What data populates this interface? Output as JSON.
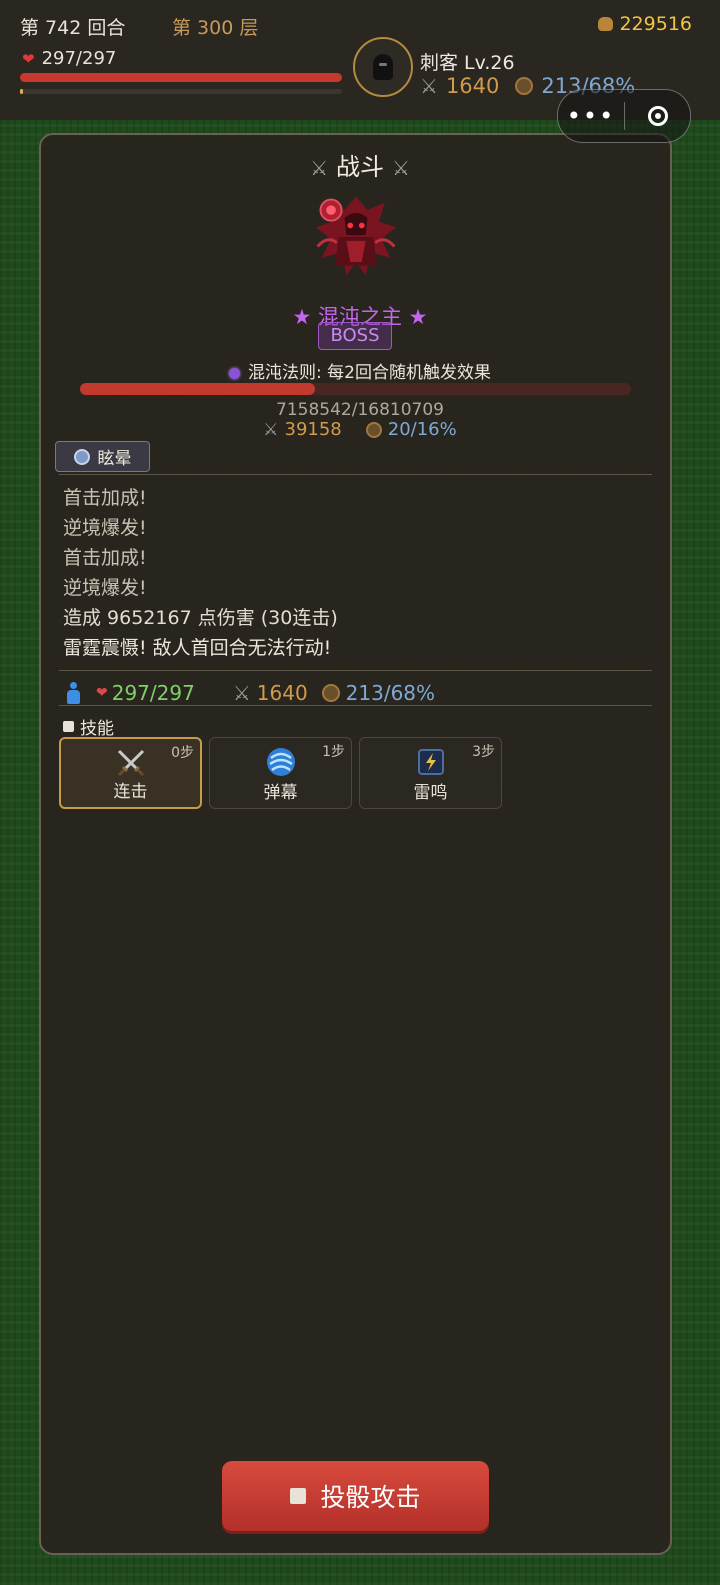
{
  "hud": {
    "turn": "第 742 回合",
    "floor": "第 300 层",
    "gold": "229516",
    "hp": "297/297",
    "class_level": "刺客 Lv.26",
    "atk": "1640",
    "def": "213/68%",
    "hp_fraction": 1.0,
    "xp_fraction": 0.01
  },
  "panel": {
    "title": "战斗",
    "boss_name": "★ 混沌之主 ★",
    "boss_tag": "BOSS",
    "trait": "混沌法则: 每2回合随机触发效果",
    "boss_hp": "7158542/16810709",
    "boss_hp_fraction": 0.426,
    "boss_atk": "39158",
    "boss_def": "20/16%",
    "status": "眩晕",
    "log": [
      "首击加成!",
      "逆境爆发!",
      "首击加成!",
      "逆境爆发!",
      "造成 9652167 点伤害 (30连击)",
      "雷霆震慑! 敌人首回合无法行动!"
    ],
    "player_hp": "297/297",
    "player_atk": "1640",
    "player_def": "213/68%",
    "skills_title": "技能",
    "skills": [
      {
        "steps": "0步",
        "label": "连击",
        "icon": "crossed-swords-icon"
      },
      {
        "steps": "1步",
        "label": "弹幕",
        "icon": "vortex-icon"
      },
      {
        "steps": "3步",
        "label": "雷鸣",
        "icon": "thunder-icon"
      }
    ],
    "attack_button": "投骰攻击"
  },
  "colors": {
    "hp_red": "#c7382d",
    "boss_purple": "#c466ee",
    "atk": "#d39a4c",
    "def": "#7fa8d6",
    "gold": "#f0c545",
    "green_hp": "#7fd06a"
  }
}
